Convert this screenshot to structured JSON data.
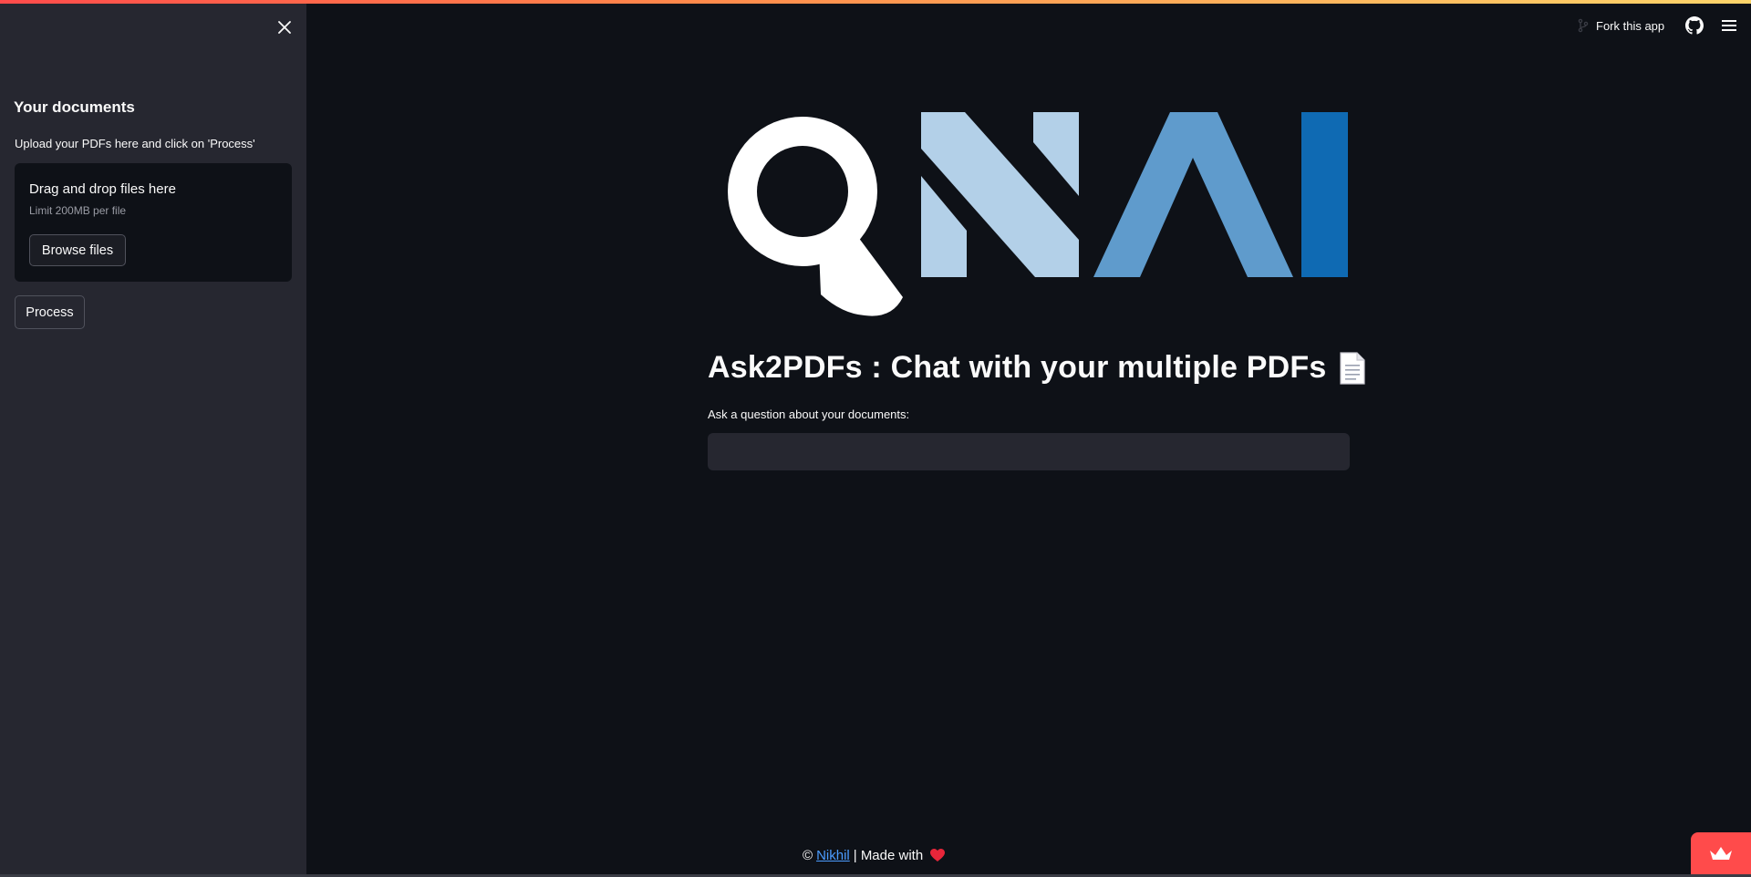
{
  "sidebar": {
    "title": "Your documents",
    "hint": "Upload your PDFs here and click on 'Process'",
    "dropzone": {
      "title": "Drag and drop files here",
      "limit": "Limit 200MB per file",
      "browse_label": "Browse files"
    },
    "process_label": "Process"
  },
  "header": {
    "fork_label": "Fork this app"
  },
  "main": {
    "logo_text": "QNAI",
    "title": "Ask2PDFs : Chat with your multiple PDFs",
    "question_label": "Ask a question about your documents:",
    "question_value": ""
  },
  "footer": {
    "copyright": "©",
    "author_link": "Nikhil",
    "made_with": "| Made with"
  },
  "colors": {
    "background": "#0e1117",
    "sidebar": "#262730",
    "accent": "#ff4b4b",
    "logo_light_blue": "#b3d0e8",
    "logo_mid_blue": "#5f9bcc",
    "logo_dark_blue": "#0f6ab3"
  },
  "icons": {
    "close": "close-icon",
    "fork": "fork-icon",
    "github": "github-icon",
    "menu": "hamburger-menu-icon",
    "document": "document-icon",
    "heart": "heart-icon",
    "crown": "crown-icon"
  }
}
